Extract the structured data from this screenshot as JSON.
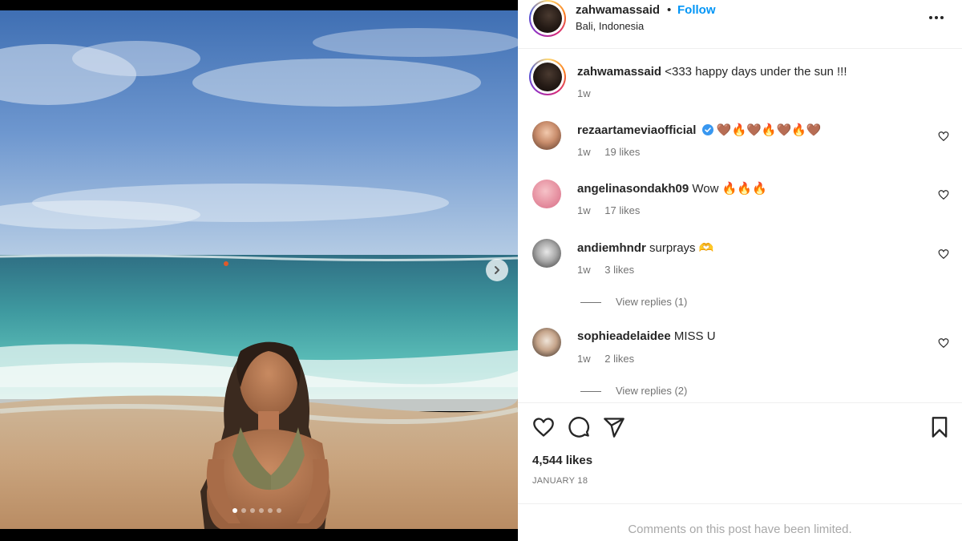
{
  "post": {
    "username": "zahwamassaid",
    "separator": "•",
    "follow_label": "Follow",
    "location": "Bali, Indonesia",
    "caption": "<333 happy days under the sun !!!",
    "caption_time": "1w",
    "likes": "4,544 likes",
    "date": "JANUARY 18",
    "limited_notice": "Comments on this post have been limited.",
    "carousel": {
      "slide_count": 6,
      "active_index": 0
    }
  },
  "comments": [
    {
      "username": "rezaartameviaofficial",
      "verified": true,
      "text": "🤎🔥🤎🔥🤎🔥🤎",
      "time": "1w",
      "likes": "19 likes",
      "replies": ""
    },
    {
      "username": "angelinasondakh09",
      "verified": false,
      "text": "Wow 🔥🔥🔥",
      "time": "1w",
      "likes": "17 likes",
      "replies": ""
    },
    {
      "username": "andiemhndr",
      "verified": false,
      "text": "surprays 🫶",
      "time": "1w",
      "likes": "3 likes",
      "replies": "View replies (1)"
    },
    {
      "username": "sophieadelaidee",
      "verified": false,
      "text": "MISS U",
      "time": "1w",
      "likes": "2 likes",
      "replies": "View replies (2)"
    }
  ],
  "icons": {
    "more": "more-options-icon",
    "next": "chevron-right-icon",
    "like": "heart-icon",
    "comment": "comment-icon",
    "share": "share-icon",
    "save": "bookmark-icon",
    "verified": "verified-badge-icon"
  },
  "colors": {
    "follow": "#0095f6",
    "verified": "#3897f0",
    "muted": "#737373",
    "limited": "#a8a8a8"
  }
}
